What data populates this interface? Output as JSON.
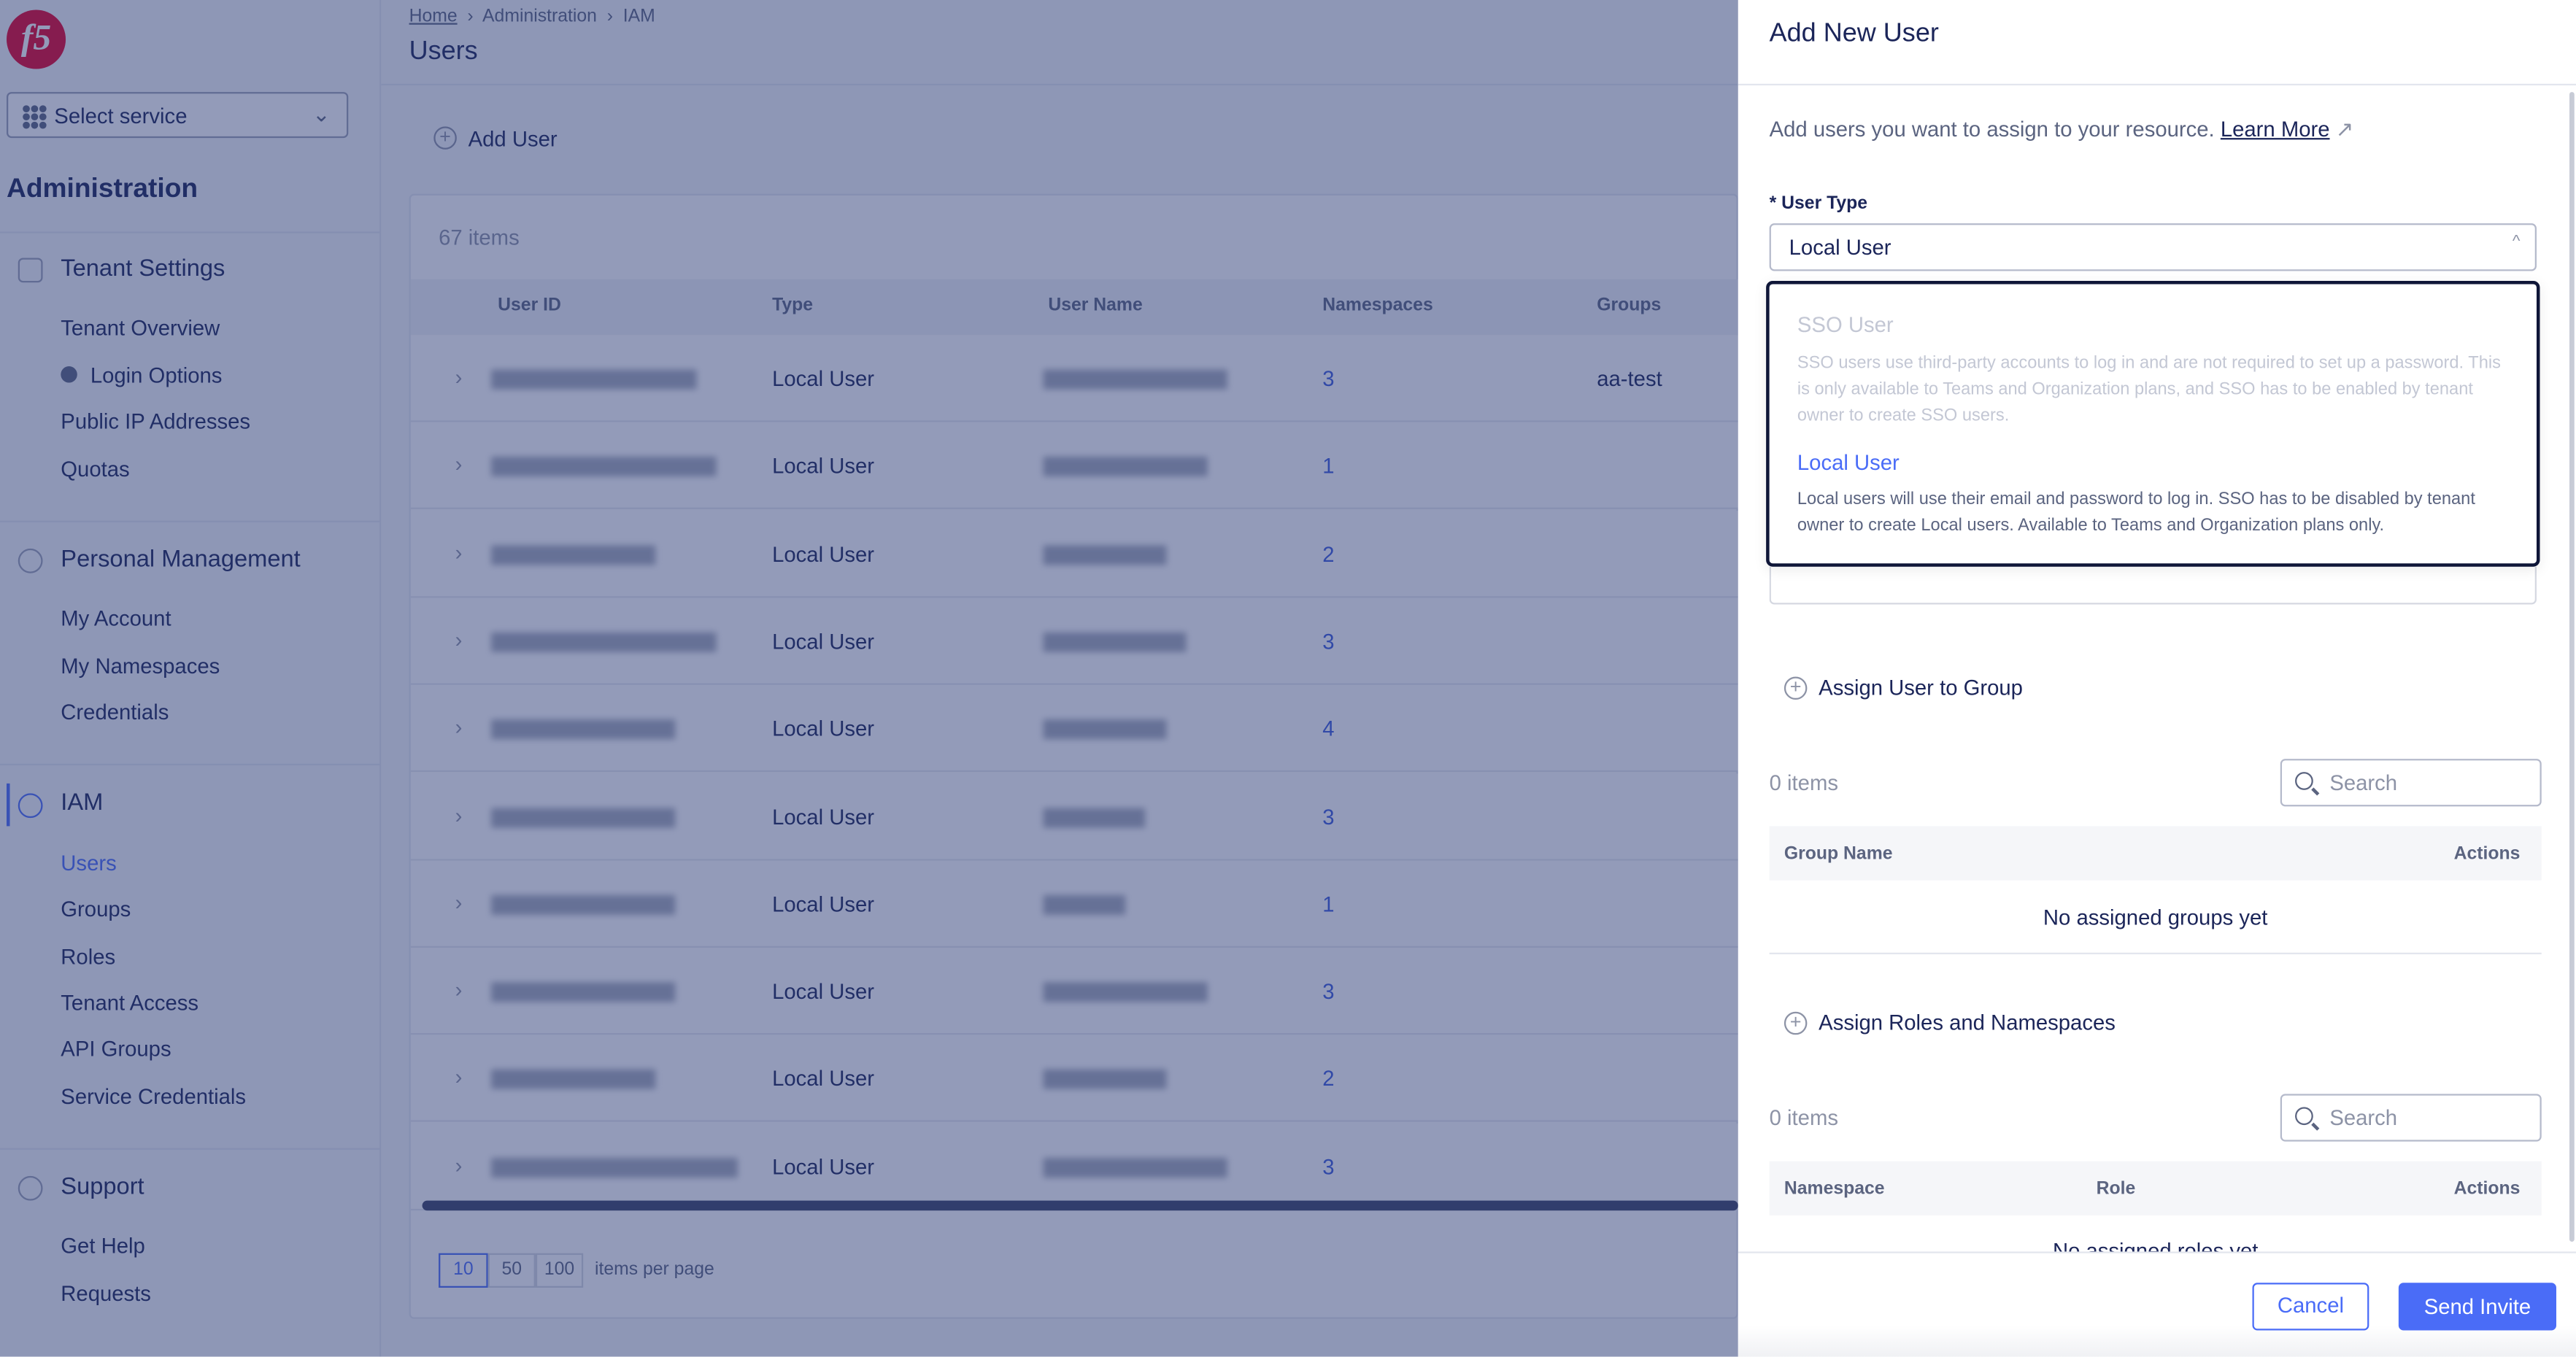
{
  "sidebar": {
    "logo": "f5",
    "service_select": "Select service",
    "title": "Administration",
    "sections": [
      {
        "label": "Tenant Settings",
        "icon": "building-gear-icon",
        "items": [
          "Tenant Overview",
          "Login Options",
          "Public IP Addresses",
          "Quotas"
        ]
      },
      {
        "label": "Personal Management",
        "icon": "user-gear-icon",
        "items": [
          "My Account",
          "My Namespaces",
          "Credentials"
        ]
      },
      {
        "label": "IAM",
        "icon": "key-icon",
        "items": [
          "Users",
          "Groups",
          "Roles",
          "Tenant Access",
          "API Groups",
          "Service Credentials"
        ]
      },
      {
        "label": "Support",
        "icon": "lifebuoy-icon",
        "items": [
          "Get Help",
          "Requests"
        ]
      }
    ],
    "active_item": "Users"
  },
  "breadcrumb": [
    "Home",
    "Administration",
    "IAM"
  ],
  "page_title": "Users",
  "add_user": "Add User",
  "table": {
    "count": "67 items",
    "columns": [
      "User ID",
      "Type",
      "User Name",
      "Namespaces",
      "Groups"
    ],
    "rows": [
      {
        "type": "Local User",
        "namespaces": "3",
        "groups": "aa-test"
      },
      {
        "type": "Local User",
        "namespaces": "1",
        "groups": ""
      },
      {
        "type": "Local User",
        "namespaces": "2",
        "groups": ""
      },
      {
        "type": "Local User",
        "namespaces": "3",
        "groups": ""
      },
      {
        "type": "Local User",
        "namespaces": "4",
        "groups": ""
      },
      {
        "type": "Local User",
        "namespaces": "3",
        "groups": ""
      },
      {
        "type": "Local User",
        "namespaces": "1",
        "groups": ""
      },
      {
        "type": "Local User",
        "namespaces": "3",
        "groups": ""
      },
      {
        "type": "Local User",
        "namespaces": "2",
        "groups": ""
      },
      {
        "type": "Local User",
        "namespaces": "3",
        "groups": ""
      }
    ]
  },
  "pagination": {
    "sizes": [
      "10",
      "50",
      "100"
    ],
    "selected": "10",
    "label": "items per page"
  },
  "panel": {
    "title": "Add New User",
    "intro": "Add users you want to assign to your resource.",
    "learn_more": "Learn More",
    "user_type_label": "* User Type",
    "user_type_value": "Local User",
    "options": [
      {
        "label": "SSO User",
        "desc": "SSO users use third-party accounts to log in and are not required to set up a password. This is only available to Teams and Organization plans, and SSO has to be enabled by tenant owner to create SSO users.",
        "disabled": true
      },
      {
        "label": "Local User",
        "desc": "Local users will use their email and password to log in. SSO has to be disabled by tenant owner to create Local users. Available to Teams and Organization plans only.",
        "disabled": false
      }
    ],
    "assign_group": "Assign User to Group",
    "groups_count": "0 items",
    "search_placeholder": "Search",
    "groups_columns": [
      "Group Name",
      "Actions"
    ],
    "groups_empty": "No assigned groups yet",
    "assign_roles": "Assign Roles and Namespaces",
    "roles_count": "0 items",
    "roles_columns": [
      "Namespace",
      "Role",
      "Actions"
    ],
    "roles_empty": "No assigned roles yet",
    "cancel": "Cancel",
    "send": "Send Invite"
  },
  "colors": {
    "accent": "#4a6cf7",
    "brand": "#e4002b",
    "text": "#1b2559"
  }
}
